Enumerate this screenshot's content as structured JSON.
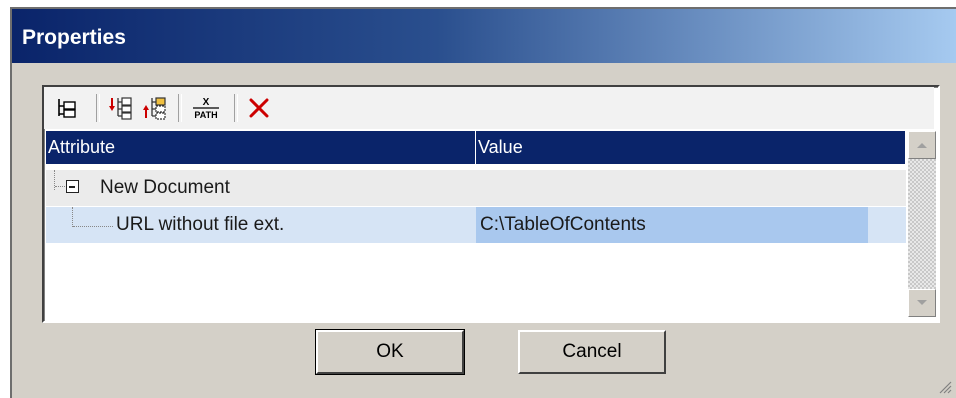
{
  "window": {
    "title": "Properties"
  },
  "toolbar": {
    "buttons": [
      {
        "icon": "tree-view-icon"
      },
      {
        "icon": "insert-element-before-icon"
      },
      {
        "icon": "insert-element-after-icon"
      },
      {
        "icon": "xpath-icon",
        "label_top": "X",
        "label_bottom": "PATH"
      },
      {
        "icon": "delete-icon"
      }
    ]
  },
  "grid": {
    "columns": [
      "Attribute",
      "Value"
    ],
    "rows": [
      {
        "attribute": "New Document",
        "value": "",
        "expanded": true
      },
      {
        "attribute": "URL without file ext.",
        "value": "C:\\TableOfContents",
        "selected": true
      }
    ]
  },
  "buttons": {
    "ok": "OK",
    "cancel": "Cancel"
  },
  "colors": {
    "title_start": "#0a246a",
    "title_end": "#a6caf0",
    "header_bg": "#0a246a",
    "selected_row": "#d6e4f5",
    "selected_cell": "#a9c8ee",
    "delete_red": "#cc0000"
  }
}
